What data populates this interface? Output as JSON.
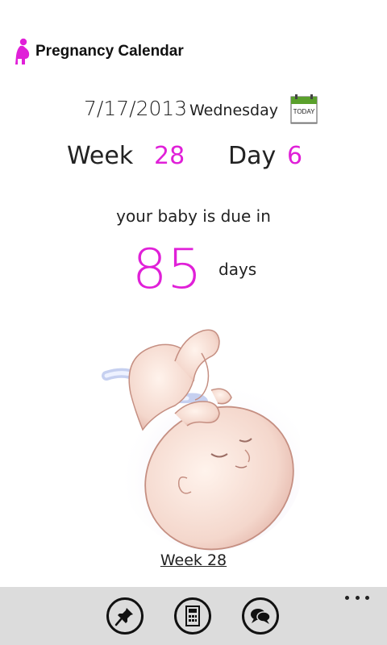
{
  "header": {
    "app_title": "Pregnancy Calendar"
  },
  "date_row": {
    "date": "7/17/2013",
    "weekday": "Wednesday",
    "today_icon_label": "TODAY"
  },
  "progress": {
    "week_label": "Week",
    "week_value": "28",
    "day_label": "Day",
    "day_value": "6"
  },
  "due": {
    "text": "your baby is due in",
    "days_value": "85",
    "days_label": "days"
  },
  "illustration": {
    "caption_link": "Week 28"
  },
  "app_bar": {
    "buttons": [
      "pin-icon",
      "calculator-icon",
      "chat-icon"
    ],
    "more_icon": "ellipsis-icon"
  },
  "colors": {
    "accent": "#e020d8",
    "appbar_bg": "#dcdcdc",
    "today_green": "#5aa02c"
  }
}
